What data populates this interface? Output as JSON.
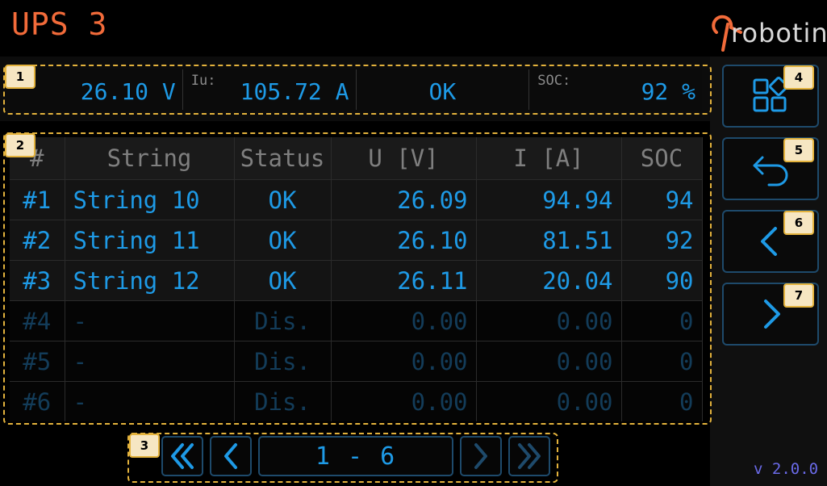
{
  "header": {
    "title": "UPS 3",
    "brand": "robotina",
    "version": "v 2.0.0"
  },
  "summary": [
    {
      "label": "",
      "value": "26.10 V"
    },
    {
      "label": "Iu:",
      "value": "105.72 A"
    },
    {
      "label": "",
      "value": "OK"
    },
    {
      "label": "SOC:",
      "value": "92 %"
    }
  ],
  "table": {
    "headers": [
      "#",
      "String",
      "Status",
      "U [V]",
      "I [A]",
      "SOC"
    ],
    "rows": [
      {
        "n": "#1",
        "name": "String 10",
        "status": "OK",
        "u": "26.09",
        "i": "94.94",
        "soc": "94"
      },
      {
        "n": "#2",
        "name": "String 11",
        "status": "OK",
        "u": "26.10",
        "i": "81.51",
        "soc": "92"
      },
      {
        "n": "#3",
        "name": "String 12",
        "status": "OK",
        "u": "26.11",
        "i": "20.04",
        "soc": "90"
      },
      {
        "n": "#4",
        "name": "-",
        "status": "Dis.",
        "u": "0.00",
        "i": "0.00",
        "soc": "0"
      },
      {
        "n": "#5",
        "name": "-",
        "status": "Dis.",
        "u": "0.00",
        "i": "0.00",
        "soc": "0"
      },
      {
        "n": "#6",
        "name": "-",
        "status": "Dis.",
        "u": "0.00",
        "i": "0.00",
        "soc": "0"
      }
    ]
  },
  "pagination": {
    "range": "1 - 6"
  },
  "annotations": [
    "1",
    "2",
    "3",
    "4",
    "5",
    "6",
    "7"
  ],
  "icons": {
    "first": "double-chevron-left-icon",
    "prev": "chevron-left-icon",
    "next": "chevron-right-icon",
    "last": "double-chevron-right-icon",
    "menu": "grid-icon",
    "back": "undo-arrow-icon"
  },
  "colors": {
    "title": "#f26b3a",
    "accent": "#1e9ae6",
    "disabled": "#133c59",
    "annotation": "#e3b23c",
    "version": "#6a6ae8"
  }
}
